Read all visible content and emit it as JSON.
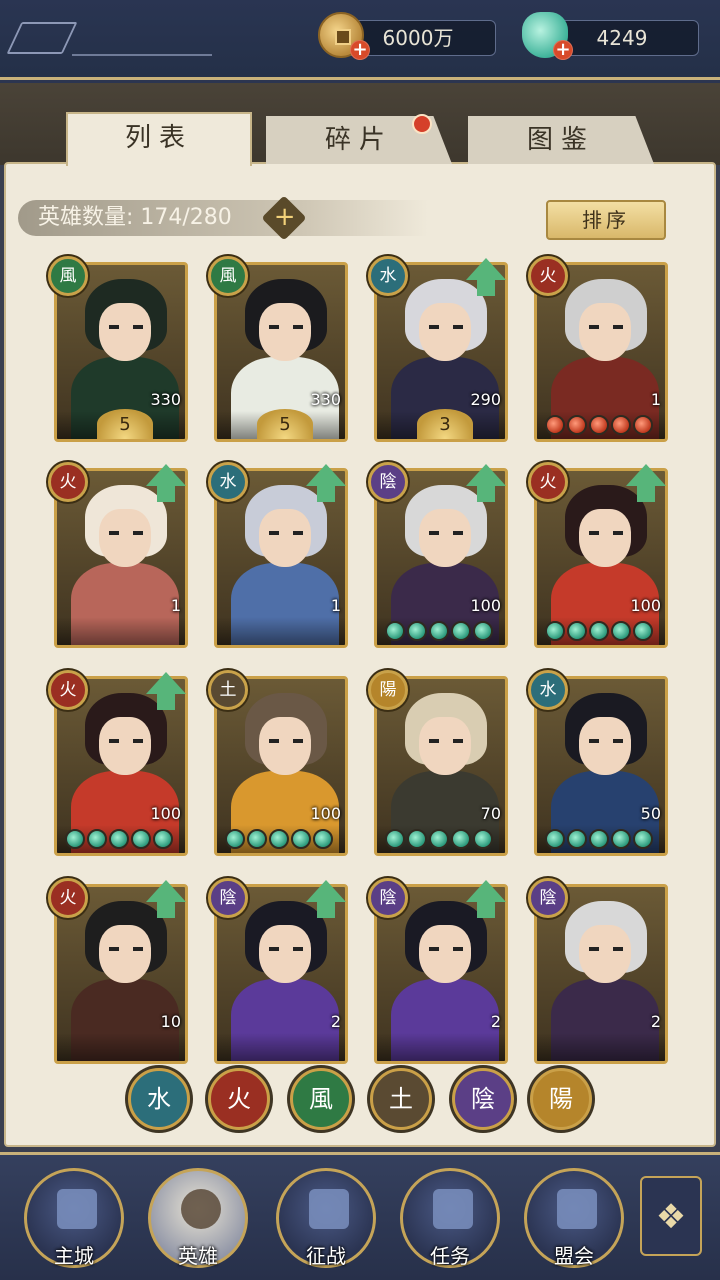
{
  "currency": {
    "gold_amount": "6000万",
    "jade_amount": "4249",
    "plus": "+"
  },
  "tabs": [
    {
      "label": "列表",
      "active": true
    },
    {
      "label": "碎片",
      "active": false,
      "has_notice": true
    },
    {
      "label": "图鉴",
      "active": false
    }
  ],
  "hero_count": {
    "label": "英雄数量: 174/280",
    "add": "+"
  },
  "sort_label": "排序",
  "elements": {
    "water": {
      "glyph": "水",
      "color": "#2c6e7a"
    },
    "fire": {
      "glyph": "火",
      "color": "#9a2f22"
    },
    "wind": {
      "glyph": "風",
      "color": "#2f7a44"
    },
    "earth": {
      "glyph": "土",
      "color": "#5a4a32"
    },
    "yin": {
      "glyph": "陰",
      "color": "#5b3f86"
    },
    "yang": {
      "glyph": "陽",
      "color": "#b5852b"
    }
  },
  "heroes": [
    {
      "element": "wind",
      "stars": "5",
      "level": "330",
      "upgrade": false,
      "orbs": "",
      "hair": "#1e2a22",
      "body": "#1f3a2a"
    },
    {
      "element": "wind",
      "stars": "5",
      "level": "330",
      "upgrade": false,
      "orbs": "",
      "hair": "#1b1b1e",
      "body": "#e8ebe2"
    },
    {
      "element": "water",
      "stars": "3",
      "level": "290",
      "upgrade": true,
      "orbs": "",
      "hair": "#d7d7dc",
      "body": "#2b2a45"
    },
    {
      "element": "fire",
      "stars": "",
      "level": "1",
      "upgrade": false,
      "orbs": "red",
      "hair": "#cfcfcf",
      "body": "#7a2a22"
    },
    {
      "element": "fire",
      "stars": "",
      "level": "1",
      "upgrade": true,
      "orbs": "",
      "hair": "#efe6d8",
      "body": "#b8665a"
    },
    {
      "element": "water",
      "stars": "",
      "level": "1",
      "upgrade": true,
      "orbs": "",
      "hair": "#c8ccd8",
      "body": "#4f6fa8"
    },
    {
      "element": "yin",
      "stars": "",
      "level": "100",
      "upgrade": true,
      "orbs": "jade",
      "hair": "#d8d8d8",
      "body": "#3b2a4a"
    },
    {
      "element": "fire",
      "stars": "",
      "level": "100",
      "upgrade": true,
      "orbs": "jade",
      "hair": "#2a1a1a",
      "body": "#c53a2a"
    },
    {
      "element": "fire",
      "stars": "",
      "level": "100",
      "upgrade": true,
      "orbs": "jade",
      "hair": "#2a1a1a",
      "body": "#c53a2a"
    },
    {
      "element": "earth",
      "stars": "",
      "level": "100",
      "upgrade": false,
      "orbs": "jade",
      "hair": "#6a5846",
      "body": "#d9982e"
    },
    {
      "element": "yang",
      "stars": "",
      "level": "70",
      "upgrade": false,
      "orbs": "jade",
      "hair": "#d9cdb2",
      "body": "#3b3a30"
    },
    {
      "element": "water",
      "stars": "",
      "level": "50",
      "upgrade": false,
      "orbs": "jade",
      "hair": "#1a1a22",
      "body": "#27416f"
    },
    {
      "element": "fire",
      "stars": "",
      "level": "10",
      "upgrade": true,
      "orbs": "",
      "hair": "#1e1e1e",
      "body": "#4a2a22"
    },
    {
      "element": "yin",
      "stars": "",
      "level": "2",
      "upgrade": true,
      "orbs": "",
      "hair": "#1a1a24",
      "body": "#5b3a9a"
    },
    {
      "element": "yin",
      "stars": "",
      "level": "2",
      "upgrade": true,
      "orbs": "",
      "hair": "#1a1a24",
      "body": "#5b3a9a"
    },
    {
      "element": "yin",
      "stars": "",
      "level": "2",
      "upgrade": false,
      "orbs": "",
      "hair": "#d8d8d8",
      "body": "#3b2a4a"
    }
  ],
  "filters": [
    "water",
    "fire",
    "wind",
    "earth",
    "yin",
    "yang"
  ],
  "nav": [
    {
      "label": "主城",
      "active": false
    },
    {
      "label": "英雄",
      "active": true
    },
    {
      "label": "征战",
      "active": false
    },
    {
      "label": "任务",
      "active": false
    },
    {
      "label": "盟会",
      "active": false
    }
  ],
  "menu_icon": "grid-menu-icon"
}
